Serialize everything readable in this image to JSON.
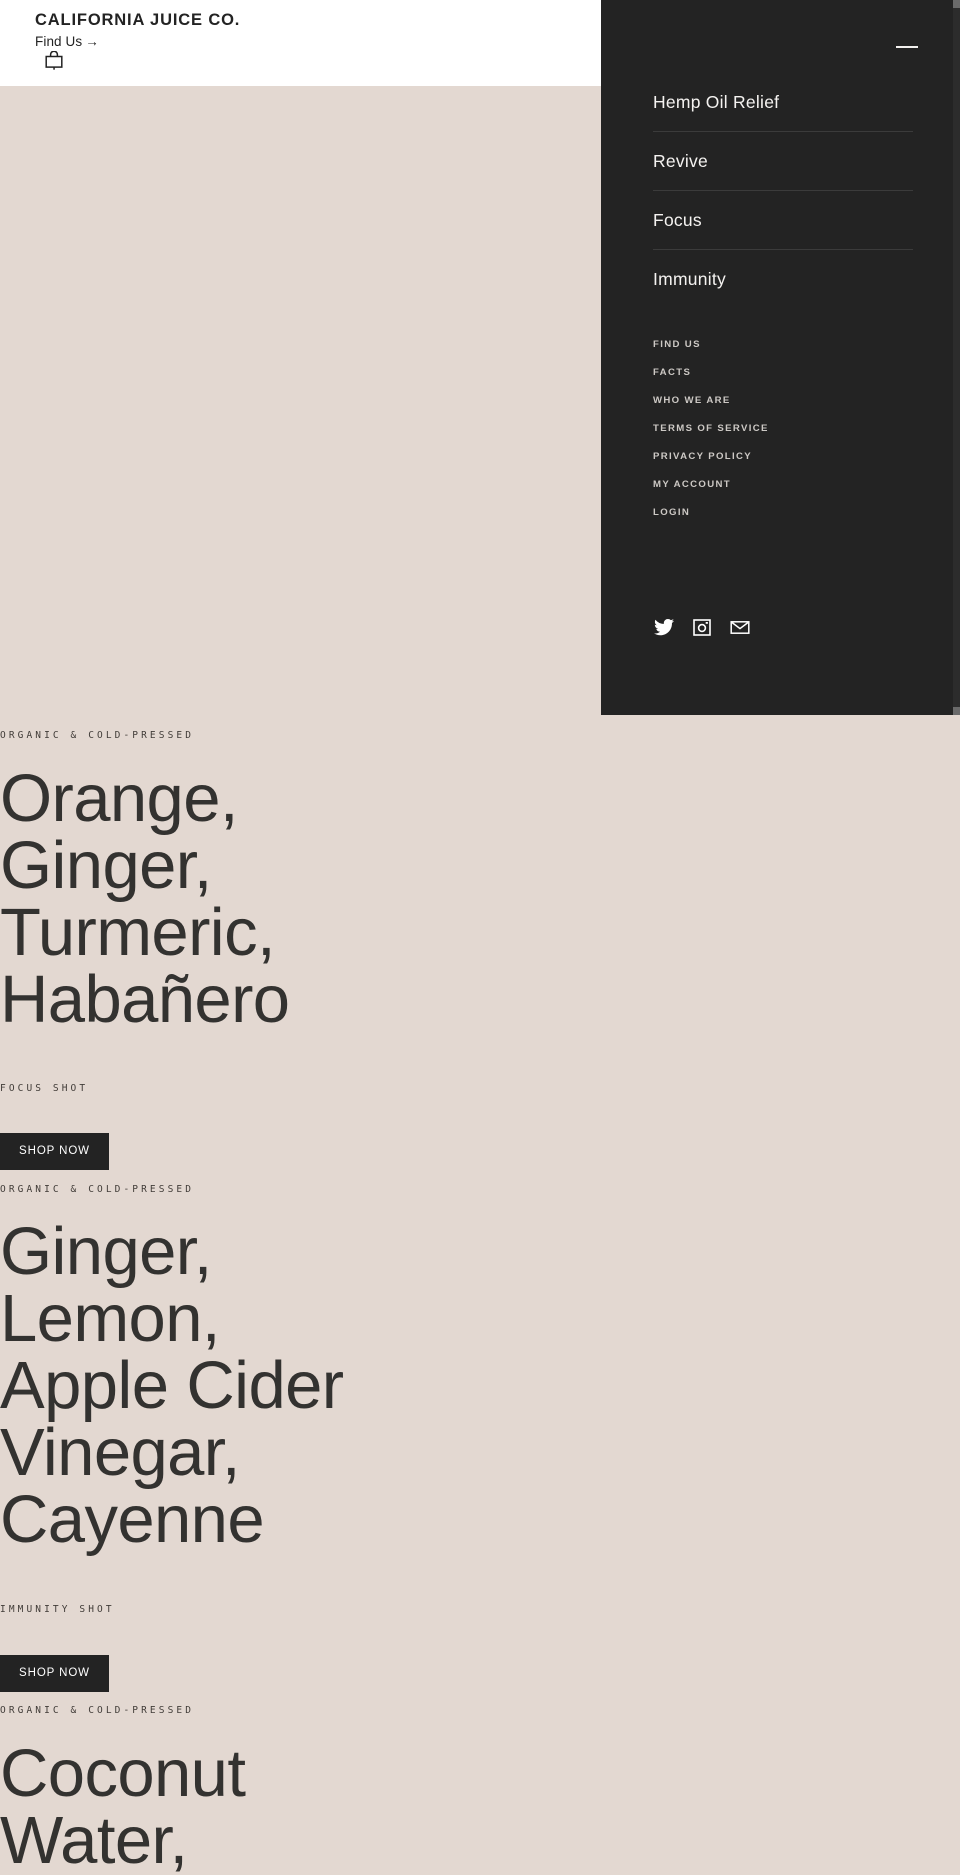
{
  "header": {
    "brand": "CALIFORNIA JUICE CO.",
    "find_us_label": "Find Us",
    "find_us_arrow": "→",
    "cart_icon": "shopping-bag-icon",
    "background": "#ffffff"
  },
  "menu": {
    "close_icon": "close-dash-icon",
    "background": "#232323",
    "primary_items": [
      {
        "label": "Hemp Oil Relief"
      },
      {
        "label": "Revive"
      },
      {
        "label": "Focus"
      },
      {
        "label": "Immunity"
      }
    ],
    "secondary_items": [
      {
        "label": "FIND US"
      },
      {
        "label": "FACTS"
      },
      {
        "label": "WHO WE ARE"
      },
      {
        "label": "TERMS OF SERVICE"
      },
      {
        "label": "PRIVACY POLICY"
      },
      {
        "label": "MY ACCOUNT"
      },
      {
        "label": "LOGIN"
      }
    ],
    "social": [
      {
        "name": "twitter-icon",
        "label": "Twitter"
      },
      {
        "name": "instagram-icon",
        "label": "Instagram"
      },
      {
        "name": "email-icon",
        "label": "Email"
      }
    ]
  },
  "theme": {
    "page_background": "#e3d8d1",
    "ink": "#333230",
    "dark": "#232323"
  },
  "sections": [
    {
      "eyebrow": "ORGANIC & COLD-PRESSED",
      "headline": "Orange,\nGinger,\nTurmeric,\nHabañero",
      "shot_label": "FOCUS SHOT",
      "cta": "SHOP NOW"
    },
    {
      "eyebrow": "ORGANIC & COLD-PRESSED",
      "headline": "Ginger,\nLemon,\nApple Cider\nVinegar,\nCayenne",
      "shot_label": "IMMUNITY SHOT",
      "cta": "SHOP NOW"
    },
    {
      "eyebrow": "ORGANIC & COLD-PRESSED",
      "headline": "Coconut\nWater,",
      "shot_label": "",
      "cta": ""
    }
  ]
}
